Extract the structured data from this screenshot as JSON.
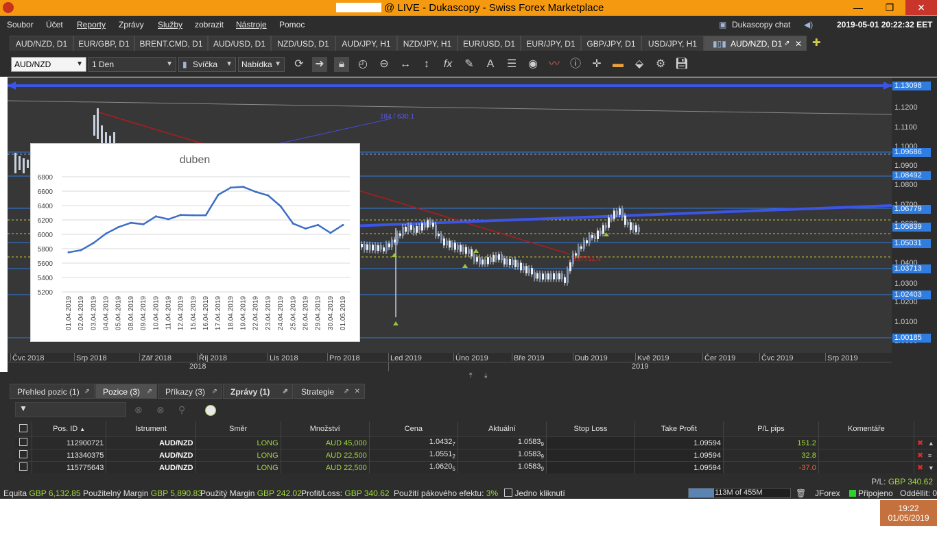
{
  "window": {
    "title": "@ LIVE - Dukascopy - Swiss Forex Marketplace",
    "min": "—",
    "max": "❐",
    "close": "✕"
  },
  "menu": [
    "Soubor",
    "Účet",
    "Reporty",
    "Zprávy",
    "Služby",
    "zobrazit",
    "Nástroje",
    "Pomoc"
  ],
  "chat": {
    "label": "Dukascopy chat"
  },
  "datetime": "2019-05-01 20:22:32 EET",
  "tabs": [
    "AUD/NZD, D1",
    "EUR/GBP, D1",
    "BRENT.CMD, D1",
    "AUD/USD, D1",
    "NZD/USD, D1",
    "AUD/JPY, H1",
    "NZD/JPY, H1",
    "EUR/USD, D1",
    "EUR/JPY, D1",
    "GBP/JPY, D1",
    "USD/JPY, H1",
    "AUD/NZD, D1"
  ],
  "toolbar": {
    "instrument": "AUD/NZD",
    "period": "1 Den",
    "style": "Svíčka",
    "side": "Nabídka"
  },
  "price_axis": {
    "ticks": [
      "1.1200",
      "1.1100",
      "1.1000",
      "1.0900",
      "1.0800",
      "1.0700",
      "1.0600",
      "1.0400",
      "1.0300",
      "1.0200",
      "1.0100",
      "1.0000"
    ],
    "boxes": [
      "1.13098",
      "1.09686",
      "1.08492",
      "1.06779",
      "1.05839",
      "1.05031",
      "1.03713",
      "1.02403",
      "1.00185"
    ]
  },
  "time_axis": {
    "months": [
      "Čvc 2018",
      "Srp 2018",
      "Zář 2018",
      "Říj 2018",
      "Lis 2018",
      "Pro 2018",
      "Led 2019",
      "Úno 2019",
      "Bře 2019",
      "Dub 2019",
      "Kvě 2019",
      "Čer 2019",
      "Čvc 2019",
      "Srp 2019"
    ],
    "years": [
      "2018",
      "2019"
    ]
  },
  "annotations": {
    "fib": "184 / 630.1",
    "red": "837711.4"
  },
  "colors": {
    "chart_bg": "#373737",
    "line_blue": "#2f7de1",
    "thick_blue": "#3b55e6",
    "red": "#b01c1c",
    "profit": "#a2d93c",
    "loss": "#e8623c"
  },
  "bottom_tabs": [
    "Přehled pozic (1)",
    "Pozice (3)",
    "Příkazy (3)",
    "Zprávy (1)",
    "Strategie"
  ],
  "positions": {
    "headers": [
      "Pos. ID",
      "Istrument",
      "Směr",
      "Množství",
      "Cena",
      "Aktuální",
      "Stop Loss",
      "Take Profit",
      "P/L pips",
      "Komentáře"
    ],
    "rows": [
      {
        "id": "112900721",
        "instrument": "AUD/NZD",
        "dir": "LONG",
        "amount": "AUD 45,000",
        "price": "1.0432",
        "price_sub": "7",
        "current": "1.0583",
        "current_sub": "9",
        "sl": "",
        "tp": "1.09594",
        "pips": "151.2",
        "comment": ""
      },
      {
        "id": "113340375",
        "instrument": "AUD/NZD",
        "dir": "LONG",
        "amount": "AUD 22,500",
        "price": "1.0551",
        "price_sub": "2",
        "current": "1.0583",
        "current_sub": "9",
        "sl": "",
        "tp": "1.09594",
        "pips": "32.8",
        "comment": ""
      },
      {
        "id": "115775643",
        "instrument": "AUD/NZD",
        "dir": "LONG",
        "amount": "AUD 22,500",
        "price": "1.0620",
        "price_sub": "5",
        "current": "1.0583",
        "current_sub": "9",
        "sl": "",
        "tp": "1.09594",
        "pips": "-37.0",
        "comment": ""
      }
    ],
    "pl_label": "P/L:",
    "pl_value": "GBP 340.62"
  },
  "status": {
    "equity_label": "Equita",
    "equity": "GBP 6,132.85",
    "usable_label": "Použitelný Margin",
    "usable": "GBP 5,890.83",
    "used_label": "Použitý Margin",
    "used": "GBP 242.02",
    "pl_label": "Profit/Loss:",
    "pl": "GBP 340.62",
    "lev_label": "Použití pákového efektu:",
    "lev": "3%",
    "oneclick": "Jedno kliknutí",
    "memory": "113M of 455M",
    "jforex": "JForex",
    "connected": "Připojeno",
    "disconnected": "Odděllit: 0"
  },
  "taskbar": {
    "time": "19:22",
    "date": "01/05/2019"
  },
  "chart_data": {
    "type": "line",
    "title": "duben",
    "categories": [
      "01.04.2019",
      "02.04.2019",
      "03.04.2019",
      "04.04.2019",
      "05.04.2019",
      "08.04.2019",
      "09.04.2019",
      "10.04.2019",
      "11.04.2019",
      "12.04.2019",
      "15.04.2019",
      "16.04.2019",
      "17.04.2019",
      "18.04.2019",
      "19.04.2019",
      "22.04.2019",
      "23.04.2019",
      "24.04.2019",
      "25.04.2019",
      "26.04.2019",
      "29.04.2019",
      "30.04.2019",
      "01.05.2019"
    ],
    "values": [
      5750,
      5780,
      5880,
      6010,
      6100,
      6160,
      6140,
      6250,
      6210,
      6270,
      6265,
      6265,
      6550,
      6650,
      6660,
      6590,
      6540,
      6390,
      6150,
      6080,
      6130,
      6020,
      6130
    ],
    "yticks": [
      "6800",
      "6600",
      "6400",
      "6200",
      "6000",
      "5800",
      "5600",
      "5400",
      "5200"
    ],
    "ylim": [
      5200,
      6800
    ],
    "color": "#3b6fc4",
    "grid": true
  }
}
